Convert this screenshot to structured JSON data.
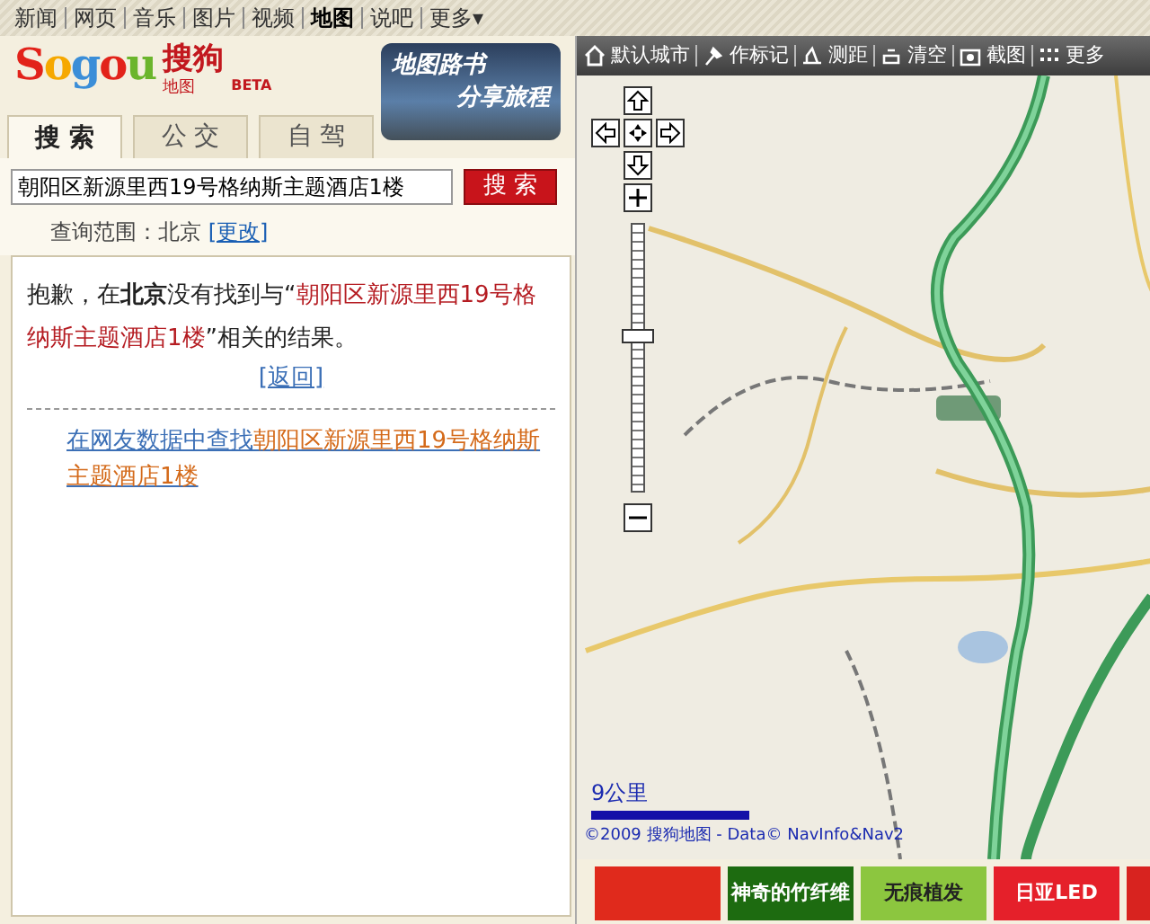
{
  "top_nav": [
    {
      "label": "新闻",
      "selected": false
    },
    {
      "label": "网页",
      "selected": false
    },
    {
      "label": "音乐",
      "selected": false
    },
    {
      "label": "图片",
      "selected": false
    },
    {
      "label": "视频",
      "selected": false
    },
    {
      "label": "地图",
      "selected": true
    },
    {
      "label": "说吧",
      "selected": false
    },
    {
      "label": "更多▾",
      "selected": false
    }
  ],
  "logo": {
    "brand": "Sogou",
    "name": "搜狗",
    "sub": "地图",
    "badge": "BETA"
  },
  "banner": {
    "line1": "地图路书",
    "line2": "分享旅程"
  },
  "tabs": [
    {
      "label": "搜 索",
      "selected": true
    },
    {
      "label": "公 交",
      "selected": false
    },
    {
      "label": "自 驾",
      "selected": false
    }
  ],
  "search": {
    "value": "朝阳区新源里西19号格纳斯主题酒店1楼",
    "button": "搜 索"
  },
  "scope": {
    "label": "查询范围：北京",
    "link": "[更改]"
  },
  "message": [
    {
      "kind": "plain",
      "text": "抱歉，在"
    },
    {
      "kind": "bold",
      "text": "北京"
    },
    {
      "kind": "plain",
      "text": "没有找到与“"
    },
    {
      "kind": "query",
      "text": "朝阳区新源里西19号格纳斯主题酒店1楼"
    },
    {
      "kind": "plain",
      "text": "”相关的结果。"
    }
  ],
  "back_link": "[返回]",
  "suggestion": {
    "prefix": "在网友数据中查找",
    "query": "朝阳区新源里西19号格纳斯主题酒店1楼"
  },
  "map_toolbar": [
    {
      "kind": "home",
      "label": "默认城市"
    },
    {
      "kind": "pin",
      "label": "作标记"
    },
    {
      "kind": "ruler",
      "label": "测距"
    },
    {
      "kind": "eraser",
      "label": "清空"
    },
    {
      "kind": "camera",
      "label": "截图"
    },
    {
      "kind": "grid",
      "label": "更多"
    }
  ],
  "map": {
    "zoom": {
      "level": 0.58
    },
    "scale": "9公里",
    "copyright": "©2009 搜狗地图 - Data© NavInfo&Nav2"
  },
  "ads": [
    {
      "kind": "logo",
      "color": "#e02a1c"
    },
    {
      "kind": "text",
      "text": "神奇的竹纤维",
      "color": "#1d6b10"
    },
    {
      "kind": "text",
      "text": "无痕植发",
      "color": "#8cc63f"
    },
    {
      "kind": "text",
      "text": "日亚LED",
      "color": "#e5202a"
    },
    {
      "kind": "logo",
      "color": "#d8231f"
    }
  ]
}
